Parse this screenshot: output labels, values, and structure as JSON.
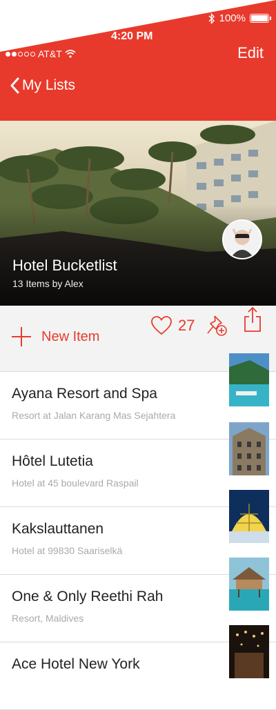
{
  "status_bar": {
    "carrier": "AT&T",
    "time": "4:20 PM",
    "battery": "100%",
    "signal_bars_filled": 2
  },
  "nav": {
    "back_label": "My Lists",
    "edit_label": "Edit"
  },
  "hero": {
    "title": "Hotel Bucketlist",
    "subtitle": "13 Items by Alex"
  },
  "actions": {
    "new_item_label": "New Item",
    "likes": "27"
  },
  "items": [
    {
      "title": "Ayana Resort and Spa",
      "subtitle": "Resort at Jalan Karang Mas Sejahtera"
    },
    {
      "title": "Hôtel Lutetia",
      "subtitle": "Hotel at 45 boulevard Raspail"
    },
    {
      "title": "Kakslauttanen",
      "subtitle": "Hotel at 99830 Saariselkä"
    },
    {
      "title": "One & Only Reethi Rah",
      "subtitle": "Resort, Maldives"
    },
    {
      "title": "Ace Hotel New York",
      "subtitle": ""
    }
  ],
  "colors": {
    "accent": "#e83a2c",
    "background": "#ffffff",
    "action_bar": "#f3f3f3"
  },
  "icons": [
    "wifi-icon",
    "bluetooth-icon",
    "battery-icon",
    "chevron-left-icon",
    "plus-icon",
    "heart-icon",
    "pin-add-icon",
    "share-icon"
  ]
}
